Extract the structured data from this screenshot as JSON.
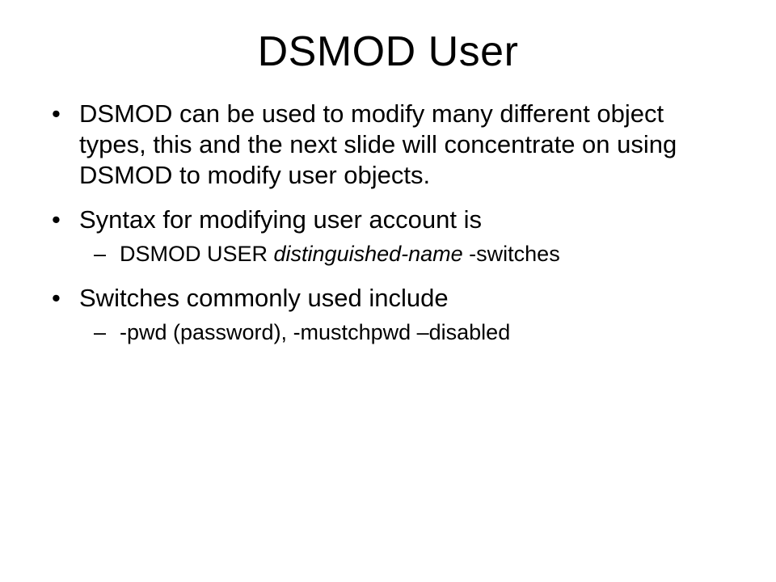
{
  "slide": {
    "title": "DSMOD User",
    "bullets": [
      {
        "text": "DSMOD can be used to modify many different object types, this and the next slide will concentrate on using DSMOD to modify user objects."
      },
      {
        "text": "Syntax for modifying user account is",
        "sub": [
          {
            "prefix": "DSMOD USER ",
            "italic": "distinguished-name",
            "suffix": " -switches"
          }
        ]
      },
      {
        "text": "Switches commonly used include",
        "sub": [
          {
            "prefix": "-pwd (password), -mustchpwd –disabled",
            "italic": "",
            "suffix": ""
          }
        ]
      }
    ]
  }
}
